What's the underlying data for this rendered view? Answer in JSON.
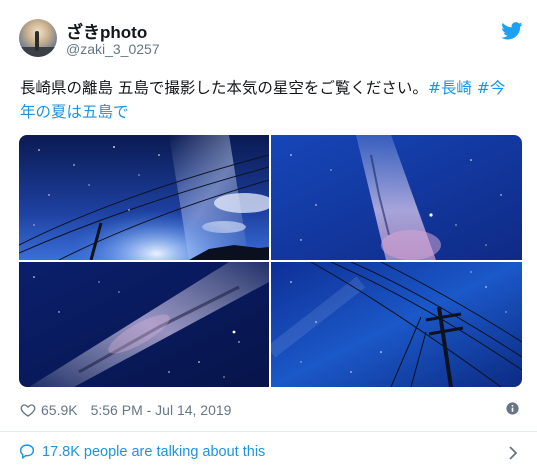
{
  "author": {
    "display_name": "ざきphoto",
    "handle": "@zaki_3_0257"
  },
  "brand_icon": "twitter-bird-icon",
  "tweet": {
    "text": "長崎県の離島 五島で撮影した本気の星空をご覧ください。",
    "hashtags": [
      "#長崎",
      "#今年の夏は五島で"
    ]
  },
  "media": {
    "photos": [
      "photo-1",
      "photo-2",
      "photo-3",
      "photo-4"
    ]
  },
  "stats": {
    "likes": "65.9K",
    "timestamp": "5:56 PM - Jul 14, 2019"
  },
  "footer": {
    "talking": "17.8K people are talking about this"
  },
  "colors": {
    "accent": "#1b95e0",
    "muted": "#657786",
    "text": "#14171a"
  }
}
